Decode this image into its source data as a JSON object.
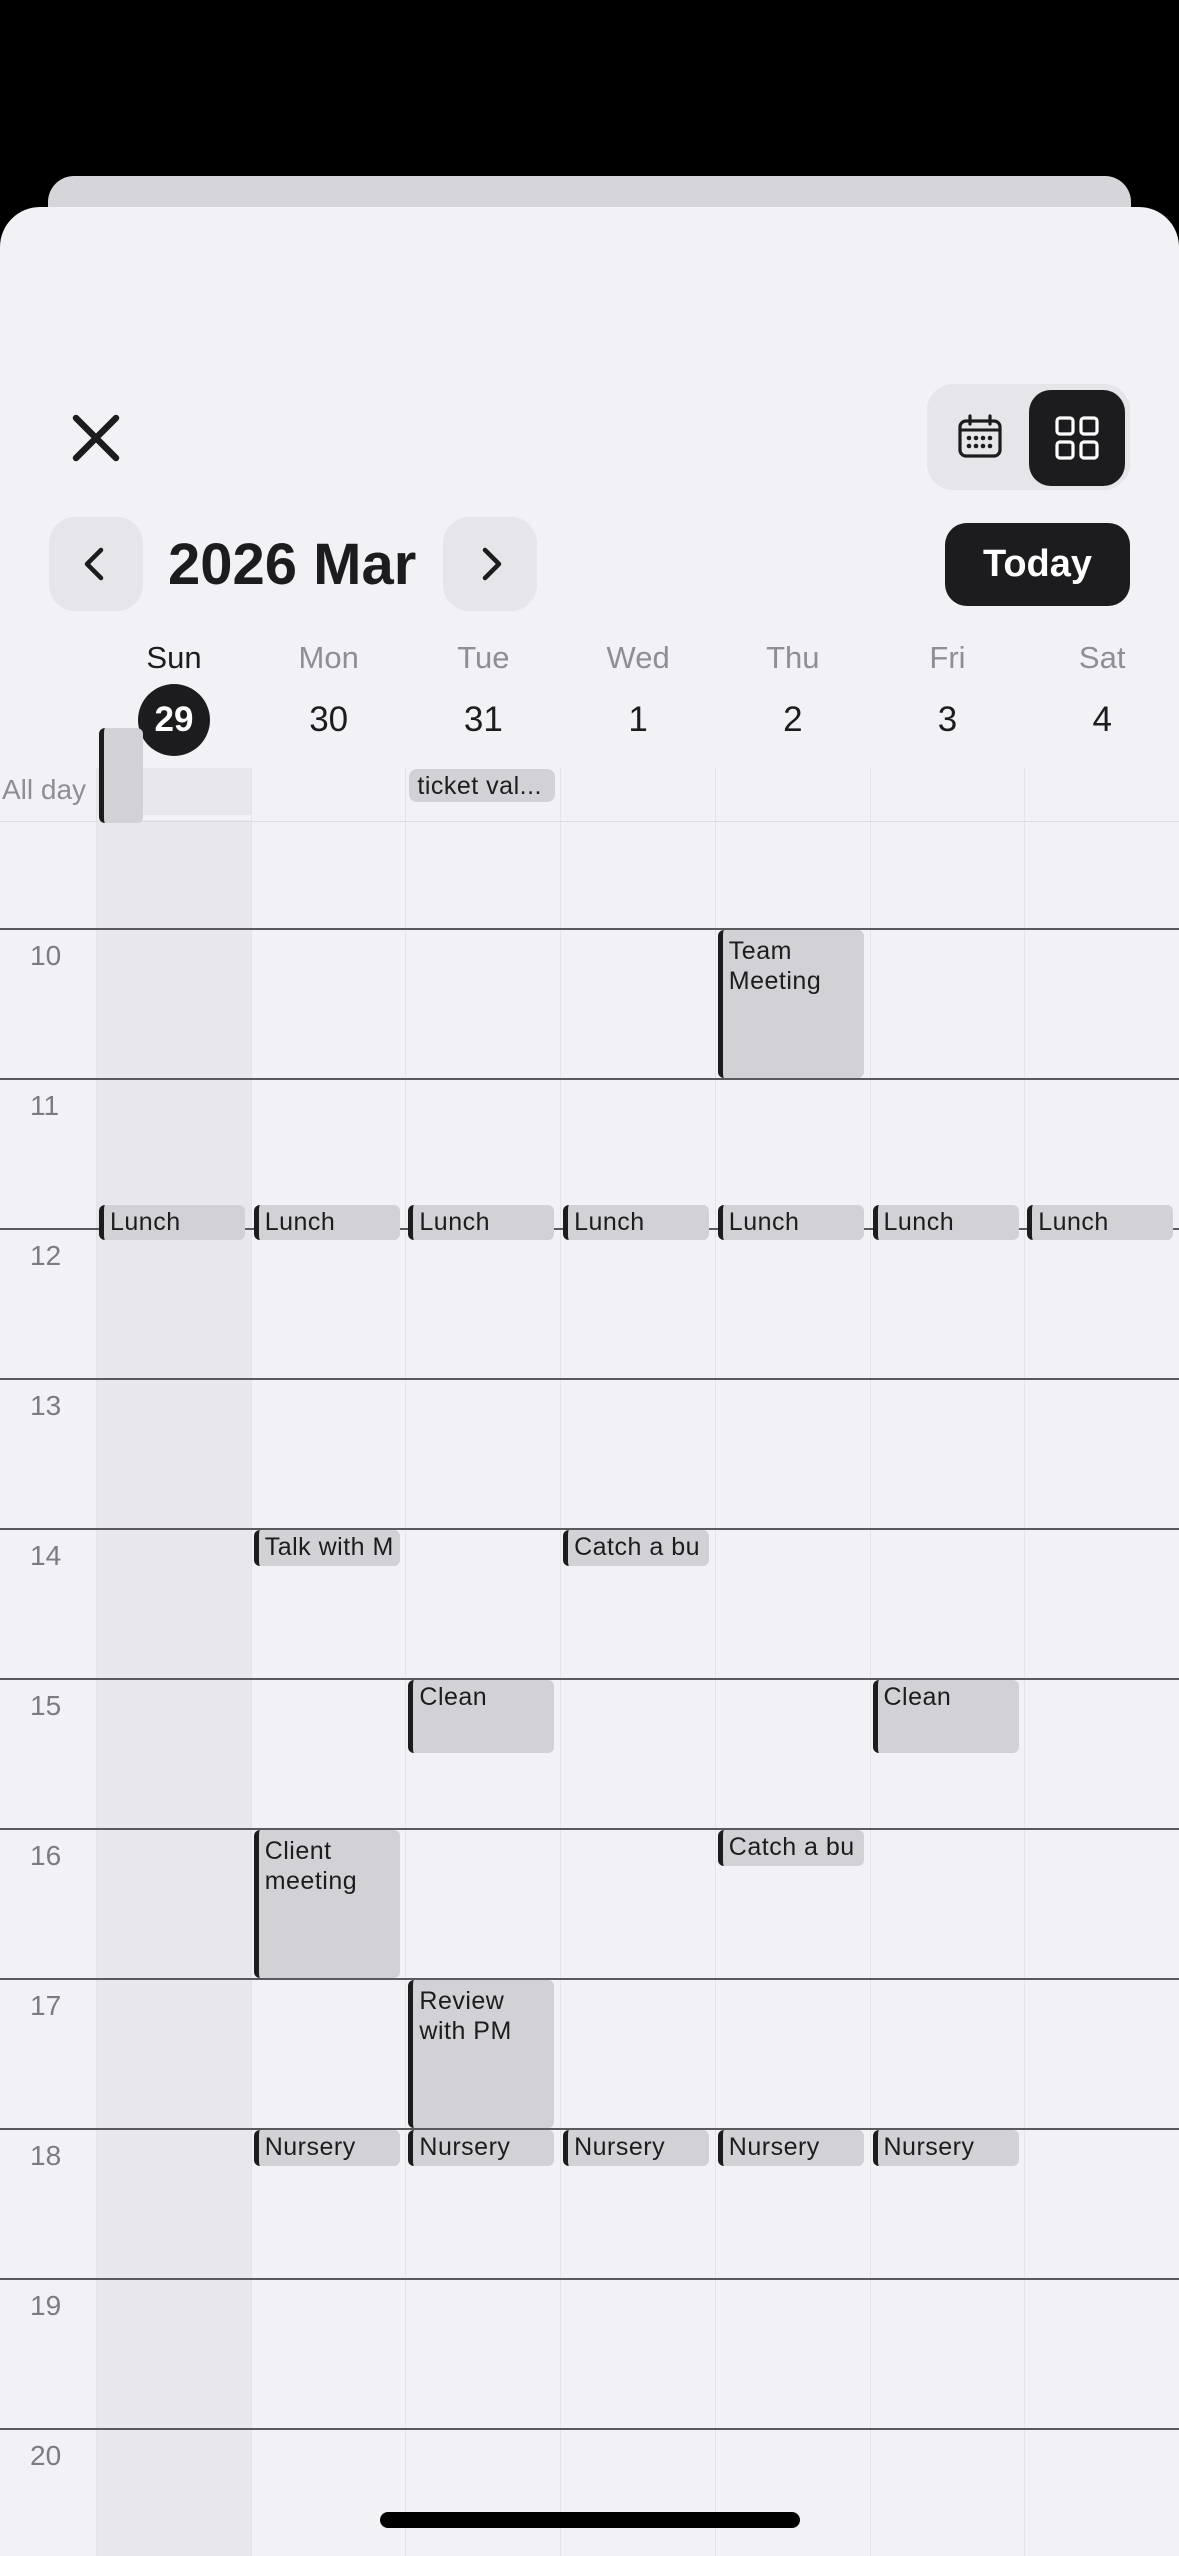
{
  "header": {
    "month_title": "2026 Mar",
    "today_label": "Today"
  },
  "icons": {
    "close": "close-icon",
    "calendar_view": "calendar-icon",
    "grid_view": "grid-icon",
    "prev": "chevron-left-icon",
    "next": "chevron-right-icon"
  },
  "week": {
    "days": [
      {
        "name": "Sun",
        "num": "29",
        "current": true
      },
      {
        "name": "Mon",
        "num": "30"
      },
      {
        "name": "Tue",
        "num": "31"
      },
      {
        "name": "Wed",
        "num": "1"
      },
      {
        "name": "Thu",
        "num": "2"
      },
      {
        "name": "Fri",
        "num": "3"
      },
      {
        "name": "Sat",
        "num": "4"
      }
    ]
  },
  "allday": {
    "label": "All day",
    "events": [
      {
        "day": 2,
        "title": "ticket val..."
      }
    ]
  },
  "hours": [
    "10",
    "11",
    "12",
    "13",
    "14",
    "15",
    "16",
    "17",
    "18",
    "19",
    "20"
  ],
  "events": [
    {
      "day": 0,
      "start": 8.65,
      "end": 9.3,
      "title": ""
    },
    {
      "day": 4,
      "start": 10.0,
      "end": 11.0,
      "title": "Team Meeting"
    },
    {
      "day": 0,
      "start": 11.83,
      "end": 12.08,
      "title": "Lunch"
    },
    {
      "day": 1,
      "start": 11.83,
      "end": 12.08,
      "title": "Lunch"
    },
    {
      "day": 2,
      "start": 11.83,
      "end": 12.08,
      "title": "Lunch"
    },
    {
      "day": 3,
      "start": 11.83,
      "end": 12.08,
      "title": "Lunch"
    },
    {
      "day": 4,
      "start": 11.83,
      "end": 12.08,
      "title": "Lunch"
    },
    {
      "day": 5,
      "start": 11.83,
      "end": 12.08,
      "title": "Lunch"
    },
    {
      "day": 6,
      "start": 11.83,
      "end": 12.08,
      "title": "Lunch"
    },
    {
      "day": 1,
      "start": 14.0,
      "end": 14.25,
      "title": "Talk with M"
    },
    {
      "day": 3,
      "start": 14.0,
      "end": 14.25,
      "title": "Catch a bu"
    },
    {
      "day": 2,
      "start": 15.0,
      "end": 15.5,
      "title": "Clean"
    },
    {
      "day": 5,
      "start": 15.0,
      "end": 15.5,
      "title": "Clean"
    },
    {
      "day": 1,
      "start": 16.0,
      "end": 17.0,
      "title": "Client meeting"
    },
    {
      "day": 4,
      "start": 16.0,
      "end": 16.25,
      "title": "Catch a bu"
    },
    {
      "day": 2,
      "start": 17.0,
      "end": 18.0,
      "title": "Review with PM"
    },
    {
      "day": 1,
      "start": 18.0,
      "end": 18.25,
      "title": "Nursery"
    },
    {
      "day": 2,
      "start": 18.0,
      "end": 18.25,
      "title": "Nursery"
    },
    {
      "day": 3,
      "start": 18.0,
      "end": 18.25,
      "title": "Nursery"
    },
    {
      "day": 4,
      "start": 18.0,
      "end": 18.25,
      "title": "Nursery"
    },
    {
      "day": 5,
      "start": 18.0,
      "end": 18.25,
      "title": "Nursery"
    }
  ]
}
